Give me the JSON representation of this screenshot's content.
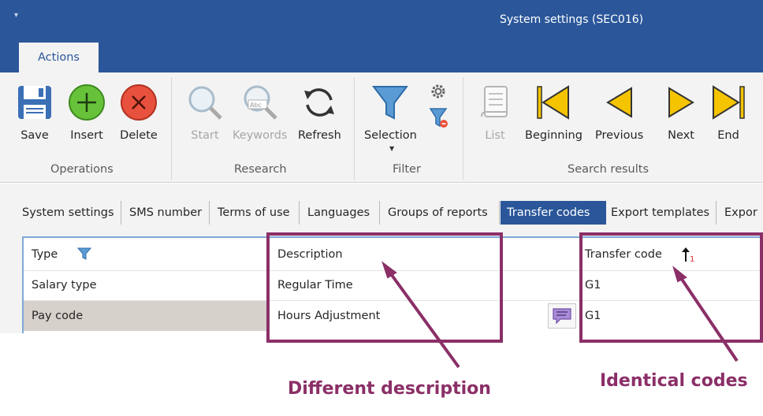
{
  "window": {
    "title": "System settings (SEC016)",
    "quick_access": "▾"
  },
  "ribbon_tab": {
    "label": "Actions"
  },
  "ribbon": {
    "groups": [
      {
        "label": "Operations"
      },
      {
        "label": "Research"
      },
      {
        "label": "Filter"
      },
      {
        "label": "Search results"
      }
    ],
    "buttons": {
      "save": "Save",
      "insert": "Insert",
      "delete": "Delete",
      "start": "Start",
      "keywords": "Keywords",
      "refresh": "Refresh",
      "selection": "Selection",
      "list": "List",
      "beginning": "Beginning",
      "previous": "Previous",
      "next": "Next",
      "end": "End"
    }
  },
  "tabs": [
    "System settings",
    "SMS number",
    "Terms of use",
    "Languages",
    "Groups of reports",
    "Transfer codes",
    "Export templates",
    "Expor"
  ],
  "active_tab_index": 5,
  "grid": {
    "columns": [
      "Type",
      "Description",
      "Transfer code"
    ],
    "rows": [
      {
        "type": "Salary type",
        "description": "Regular Time",
        "code": "G1"
      },
      {
        "type": "Pay code",
        "description": "Hours Adjustment",
        "code": "G1"
      }
    ]
  },
  "annotations": {
    "left": "Different description",
    "right": "Identical codes"
  },
  "colors": {
    "titlebar": "#2b579a",
    "annotation": "#8b2f67",
    "go_arrows": "#f5c400",
    "insert_green": "#67c23a",
    "delete_red": "#e8513d"
  }
}
